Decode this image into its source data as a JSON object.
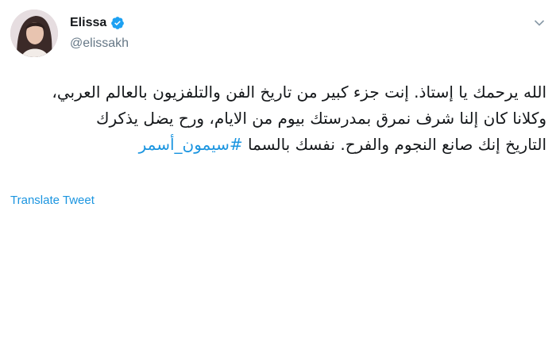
{
  "tweet": {
    "author": {
      "display_name": "Elissa",
      "handle": "@elissakh",
      "verified": true
    },
    "text_lines": [
      "الله يرحمك يا إستاذ. إنت جزء كبير من تاريخ الفن والتلفزيون بالعالم العربي،",
      "وكلانا كان إلنا شرف نمرق بمدرستك بيوم من الايام، ورح يضل يذكرك",
      "التاريخ إنك صانع النجوم والفرح. نفسك بالسما"
    ],
    "hashtag": "#سيمون_أسمر",
    "translate_label": "Translate Tweet"
  },
  "colors": {
    "link": "#1b95e0",
    "text": "#14171a",
    "muted": "#657786"
  },
  "icons": {
    "verified": "verified-badge-icon",
    "menu": "chevron-down-icon",
    "avatar": "profile-photo"
  }
}
